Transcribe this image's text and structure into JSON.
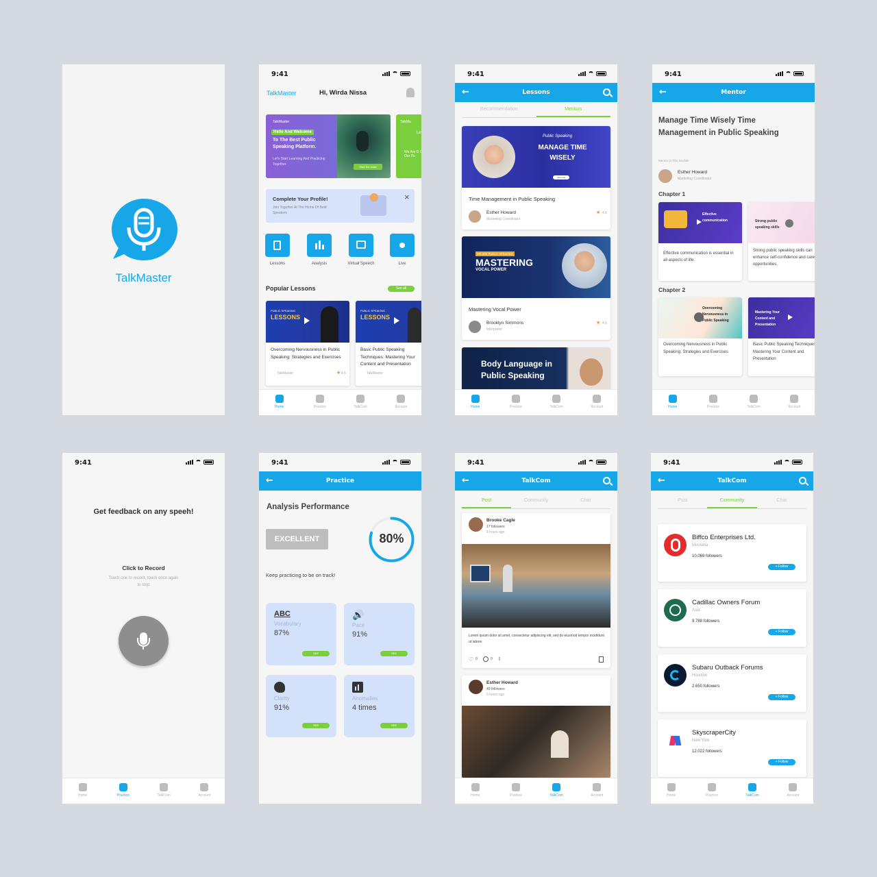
{
  "status_time": "9:41",
  "splash": {
    "app_name": "TalkMaster"
  },
  "home": {
    "brand": "TalkMaster",
    "greeting": "Hi, Wirda Nissa",
    "banner": {
      "brand": "TalkMaster",
      "highlight": "Hello And Welcome",
      "title": "To The Best Public Speaking Platform.",
      "subtitle": "Let's Start Learning And Practicing Together.",
      "cta": "Start the class"
    },
    "banner2": {
      "brand": "TalkMa",
      "title": "Le",
      "subtitle": "We Are D Of Our Pu"
    },
    "profile": {
      "title": "Complete Your Profile!",
      "subtitle": "Join Together At The Home Of Bold Speakers"
    },
    "quick": [
      "Lessons",
      "Analysis",
      "Virtual Speech",
      "Live"
    ],
    "popular_title": "Popular Lessons",
    "see_all": "See all",
    "lessons": [
      {
        "tag": "PUBLIC SPEAKING",
        "thumb": "LESSONS",
        "title": "Overcoming Nervousness in Public Speaking: Strategies and Exercises",
        "brand": "TalkMaster",
        "rating": "4.6"
      },
      {
        "tag": "PUBLIC SPEAKING",
        "thumb": "LESSONS",
        "title": "Basic Public Speaking Techniques: Mastering Your Content and Presentation",
        "brand": "TalkMaster",
        "rating": "4.6"
      }
    ]
  },
  "tabbar": [
    "Home",
    "Practice",
    "TalkCom",
    "Account"
  ],
  "lessons_screen": {
    "header": "Lessons",
    "tabs": [
      "Recommendation",
      "Mentors"
    ],
    "cards": [
      {
        "thumb_small": "Public Speaking",
        "thumb_title": "MANAGE TIME WISELY",
        "thumb_cta": "Join now",
        "title": "Time Management in Public Speaking",
        "mentor": "Esther Howard",
        "role": "Marketing Coordinator",
        "rating": "4.6"
      },
      {
        "thumb_small": "WE ARE PUBLIC SPEAKING",
        "thumb_title": "MASTERING",
        "thumb_sub": "VOCAL POWER",
        "title": "Mastering Vocal Power",
        "mentor": "Brooklyn Simmons",
        "role": "Interpreter",
        "rating": "4.6"
      },
      {
        "thumb_title": "Body Language in Public Speaking"
      }
    ]
  },
  "mentor_screen": {
    "header": "Mentor",
    "title": "Manage Time Wisely Time Management in Public Speaking",
    "mentor_label": "Mentor In This Module",
    "mentor": "Esther Howard",
    "role": "Marketing Coordinator",
    "chapter1": "Chapter 1",
    "chapter2": "Chapter 2",
    "c1": [
      {
        "thumb": "Effective communication",
        "desc": "Effective communication is essential in all aspects of life."
      },
      {
        "thumb": "Strong public speaking skills",
        "desc": "Strong public speaking skills can enhance self-confidence and career opportunities."
      }
    ],
    "c2": [
      {
        "thumb": "Overcoming Nervousness in Public Speaking",
        "desc": "Overcoming Nervousness in Public Speaking: Strategies and Exercises"
      },
      {
        "thumb": "Mastering Your Content and Presentation",
        "desc": "Basic Public Speaking Techniques: Mastering Your Content and Presentation"
      }
    ]
  },
  "record_screen": {
    "title": "Get feedback on any speeh!",
    "cta": "Click to Record",
    "hint": "Touch one to record, touch once again to stop"
  },
  "practice_screen": {
    "header": "Practice",
    "title": "Analysis Performance",
    "badge": "EXCELLENT",
    "score_label": "80%",
    "score": 0.8,
    "subtitle": "Keep practicing to be on track!",
    "tiles": [
      {
        "label": "Vocabulary",
        "value": "87%",
        "btn": "SEE",
        "icon": "abc-icon"
      },
      {
        "label": "Pace",
        "value": "91%",
        "btn": "SEE",
        "icon": "speaker-icon"
      },
      {
        "label": "Clarity",
        "value": "91%",
        "btn": "SEE",
        "icon": "speaking-head-icon"
      },
      {
        "label": "Anomalies",
        "value": "4 times",
        "btn": "SEE",
        "icon": "chart-icon"
      }
    ]
  },
  "talkcom_post": {
    "header": "TalkCom",
    "tabs": [
      "Post",
      "Community",
      "Chat"
    ],
    "posts": [
      {
        "name": "Brooke Cagle",
        "followers": "17 followers",
        "time": "4 hours ago",
        "text": "Lorem ipsum dolor sit amet, consectetur adipiscing elit, sed do eiusmod tempor incididunt ut labore",
        "likes": "0",
        "comments": "0"
      },
      {
        "name": "Esther Howard",
        "followers": "49 followers",
        "time": "5 hours ago"
      }
    ]
  },
  "talkcom_community": {
    "header": "TalkCom",
    "tabs": [
      "Post",
      "Community",
      "Chat"
    ],
    "follow": "+ Follow",
    "items": [
      {
        "name": "Biffco Enterprises Ltd.",
        "location": "Montana",
        "followers": "10.069 followers",
        "color": "#e52b2b"
      },
      {
        "name": "Cadillac Owners Forum",
        "location": "Asia",
        "followers": "9.788 followers",
        "color": "#1e6b4d"
      },
      {
        "name": "Subaru Outback Forums",
        "location": "Houston",
        "followers": "2.650 followers",
        "color": "#0a1a33"
      },
      {
        "name": "SkyscraperCity",
        "location": "New York",
        "followers": "12.022 followers",
        "color": "#e7356b"
      }
    ]
  },
  "colors": {
    "primary": "#17a7e8",
    "accent": "#7ccf3c",
    "tile": "#d4e1fb"
  }
}
